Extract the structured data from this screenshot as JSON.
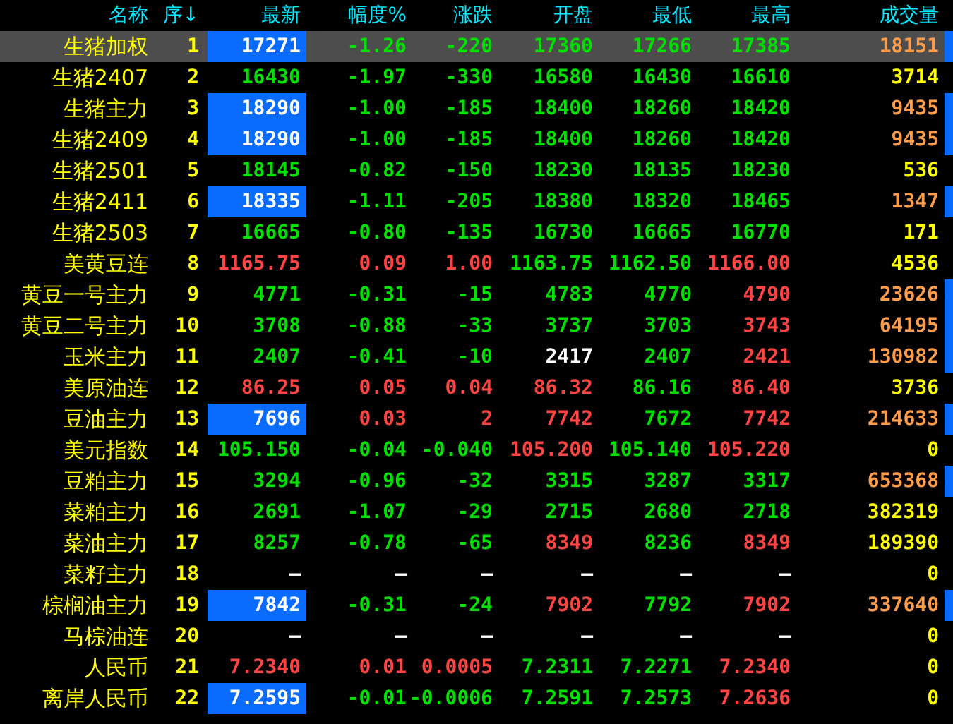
{
  "columns": [
    "名称",
    "序↓",
    "最新",
    "幅度%",
    "涨跌",
    "开盘",
    "最低",
    "最高",
    "成交量"
  ],
  "rows": [
    {
      "name": "生猪加权",
      "seq": "1",
      "selected": true,
      "highlight": true,
      "marker": true,
      "cells": [
        {
          "text": "17271",
          "color": "#ffffff"
        },
        {
          "text": "-1.26",
          "color": "#00e000"
        },
        {
          "text": "-220",
          "color": "#00e000"
        },
        {
          "text": "17360",
          "color": "#00e000"
        },
        {
          "text": "17266",
          "color": "#00e000"
        },
        {
          "text": "17385",
          "color": "#00e000"
        },
        {
          "text": "18151",
          "color": "#ff9d4d"
        }
      ]
    },
    {
      "name": "生猪2407",
      "seq": "2",
      "selected": false,
      "highlight": false,
      "marker": false,
      "cells": [
        {
          "text": "16430",
          "color": "#00e000"
        },
        {
          "text": "-1.97",
          "color": "#00e000"
        },
        {
          "text": "-330",
          "color": "#00e000"
        },
        {
          "text": "16580",
          "color": "#00e000"
        },
        {
          "text": "16430",
          "color": "#00e000"
        },
        {
          "text": "16610",
          "color": "#00e000"
        },
        {
          "text": "3714",
          "color": "#ffff00"
        }
      ]
    },
    {
      "name": "生猪主力",
      "seq": "3",
      "selected": false,
      "highlight": true,
      "marker": true,
      "cells": [
        {
          "text": "18290",
          "color": "#ffffff"
        },
        {
          "text": "-1.00",
          "color": "#00e000"
        },
        {
          "text": "-185",
          "color": "#00e000"
        },
        {
          "text": "18400",
          "color": "#00e000"
        },
        {
          "text": "18260",
          "color": "#00e000"
        },
        {
          "text": "18420",
          "color": "#00e000"
        },
        {
          "text": "9435",
          "color": "#ff9d4d"
        }
      ]
    },
    {
      "name": "生猪2409",
      "seq": "4",
      "selected": false,
      "highlight": true,
      "marker": true,
      "cells": [
        {
          "text": "18290",
          "color": "#ffffff"
        },
        {
          "text": "-1.00",
          "color": "#00e000"
        },
        {
          "text": "-185",
          "color": "#00e000"
        },
        {
          "text": "18400",
          "color": "#00e000"
        },
        {
          "text": "18260",
          "color": "#00e000"
        },
        {
          "text": "18420",
          "color": "#00e000"
        },
        {
          "text": "9435",
          "color": "#ff9d4d"
        }
      ]
    },
    {
      "name": "生猪2501",
      "seq": "5",
      "selected": false,
      "highlight": false,
      "marker": false,
      "cells": [
        {
          "text": "18145",
          "color": "#00e000"
        },
        {
          "text": "-0.82",
          "color": "#00e000"
        },
        {
          "text": "-150",
          "color": "#00e000"
        },
        {
          "text": "18230",
          "color": "#00e000"
        },
        {
          "text": "18135",
          "color": "#00e000"
        },
        {
          "text": "18230",
          "color": "#00e000"
        },
        {
          "text": "536",
          "color": "#ffff00"
        }
      ]
    },
    {
      "name": "生猪2411",
      "seq": "6",
      "selected": false,
      "highlight": true,
      "marker": true,
      "cells": [
        {
          "text": "18335",
          "color": "#ffffff"
        },
        {
          "text": "-1.11",
          "color": "#00e000"
        },
        {
          "text": "-205",
          "color": "#00e000"
        },
        {
          "text": "18380",
          "color": "#00e000"
        },
        {
          "text": "18320",
          "color": "#00e000"
        },
        {
          "text": "18465",
          "color": "#00e000"
        },
        {
          "text": "1347",
          "color": "#ff9d4d"
        }
      ]
    },
    {
      "name": "生猪2503",
      "seq": "7",
      "selected": false,
      "highlight": false,
      "marker": false,
      "cells": [
        {
          "text": "16665",
          "color": "#00e000"
        },
        {
          "text": "-0.80",
          "color": "#00e000"
        },
        {
          "text": "-135",
          "color": "#00e000"
        },
        {
          "text": "16730",
          "color": "#00e000"
        },
        {
          "text": "16665",
          "color": "#00e000"
        },
        {
          "text": "16770",
          "color": "#00e000"
        },
        {
          "text": "171",
          "color": "#ffff00"
        }
      ]
    },
    {
      "name": "美黄豆连",
      "seq": "8",
      "selected": false,
      "highlight": false,
      "marker": false,
      "cells": [
        {
          "text": "1165.75",
          "color": "#ff4444"
        },
        {
          "text": "0.09",
          "color": "#ff4444"
        },
        {
          "text": "1.00",
          "color": "#ff4444"
        },
        {
          "text": "1163.75",
          "color": "#00e000"
        },
        {
          "text": "1162.50",
          "color": "#00e000"
        },
        {
          "text": "1166.00",
          "color": "#ff4444"
        },
        {
          "text": "4536",
          "color": "#ffff00"
        }
      ]
    },
    {
      "name": "黄豆一号主力",
      "seq": "9",
      "selected": false,
      "highlight": false,
      "marker": true,
      "cells": [
        {
          "text": "4771",
          "color": "#00e000"
        },
        {
          "text": "-0.31",
          "color": "#00e000"
        },
        {
          "text": "-15",
          "color": "#00e000"
        },
        {
          "text": "4783",
          "color": "#00e000"
        },
        {
          "text": "4770",
          "color": "#00e000"
        },
        {
          "text": "4790",
          "color": "#ff4444"
        },
        {
          "text": "23626",
          "color": "#ff9d4d"
        }
      ]
    },
    {
      "name": "黄豆二号主力",
      "seq": "10",
      "selected": false,
      "highlight": false,
      "marker": true,
      "cells": [
        {
          "text": "3708",
          "color": "#00e000"
        },
        {
          "text": "-0.88",
          "color": "#00e000"
        },
        {
          "text": "-33",
          "color": "#00e000"
        },
        {
          "text": "3737",
          "color": "#00e000"
        },
        {
          "text": "3703",
          "color": "#00e000"
        },
        {
          "text": "3743",
          "color": "#ff4444"
        },
        {
          "text": "64195",
          "color": "#ff9d4d"
        }
      ]
    },
    {
      "name": "玉米主力",
      "seq": "11",
      "selected": false,
      "highlight": false,
      "marker": true,
      "cells": [
        {
          "text": "2407",
          "color": "#00e000"
        },
        {
          "text": "-0.41",
          "color": "#00e000"
        },
        {
          "text": "-10",
          "color": "#00e000"
        },
        {
          "text": "2417",
          "color": "#ffffff"
        },
        {
          "text": "2407",
          "color": "#00e000"
        },
        {
          "text": "2421",
          "color": "#ff4444"
        },
        {
          "text": "130982",
          "color": "#ff9d4d"
        }
      ]
    },
    {
      "name": "美原油连",
      "seq": "12",
      "selected": false,
      "highlight": false,
      "marker": false,
      "cells": [
        {
          "text": "86.25",
          "color": "#ff4444"
        },
        {
          "text": "0.05",
          "color": "#ff4444"
        },
        {
          "text": "0.04",
          "color": "#ff4444"
        },
        {
          "text": "86.32",
          "color": "#ff4444"
        },
        {
          "text": "86.16",
          "color": "#00e000"
        },
        {
          "text": "86.40",
          "color": "#ff4444"
        },
        {
          "text": "3736",
          "color": "#ffff00"
        }
      ]
    },
    {
      "name": "豆油主力",
      "seq": "13",
      "selected": false,
      "highlight": true,
      "marker": true,
      "cells": [
        {
          "text": "7696",
          "color": "#ffffff"
        },
        {
          "text": "0.03",
          "color": "#ff4444"
        },
        {
          "text": "2",
          "color": "#ff4444"
        },
        {
          "text": "7742",
          "color": "#ff4444"
        },
        {
          "text": "7672",
          "color": "#00e000"
        },
        {
          "text": "7742",
          "color": "#ff4444"
        },
        {
          "text": "214633",
          "color": "#ff9d4d"
        }
      ]
    },
    {
      "name": "美元指数",
      "seq": "14",
      "selected": false,
      "highlight": false,
      "marker": false,
      "cells": [
        {
          "text": "105.150",
          "color": "#00e000"
        },
        {
          "text": "-0.04",
          "color": "#00e000"
        },
        {
          "text": "-0.040",
          "color": "#00e000"
        },
        {
          "text": "105.200",
          "color": "#ff4444"
        },
        {
          "text": "105.140",
          "color": "#00e000"
        },
        {
          "text": "105.220",
          "color": "#ff4444"
        },
        {
          "text": "0",
          "color": "#ffff00"
        }
      ]
    },
    {
      "name": "豆粕主力",
      "seq": "15",
      "selected": false,
      "highlight": false,
      "marker": true,
      "cells": [
        {
          "text": "3294",
          "color": "#00e000"
        },
        {
          "text": "-0.96",
          "color": "#00e000"
        },
        {
          "text": "-32",
          "color": "#00e000"
        },
        {
          "text": "3315",
          "color": "#00e000"
        },
        {
          "text": "3287",
          "color": "#00e000"
        },
        {
          "text": "3317",
          "color": "#00e000"
        },
        {
          "text": "653368",
          "color": "#ff9d4d"
        }
      ]
    },
    {
      "name": "菜粕主力",
      "seq": "16",
      "selected": false,
      "highlight": false,
      "marker": false,
      "cells": [
        {
          "text": "2691",
          "color": "#00e000"
        },
        {
          "text": "-1.07",
          "color": "#00e000"
        },
        {
          "text": "-29",
          "color": "#00e000"
        },
        {
          "text": "2715",
          "color": "#00e000"
        },
        {
          "text": "2680",
          "color": "#00e000"
        },
        {
          "text": "2718",
          "color": "#00e000"
        },
        {
          "text": "382319",
          "color": "#ffff00"
        }
      ]
    },
    {
      "name": "菜油主力",
      "seq": "17",
      "selected": false,
      "highlight": false,
      "marker": false,
      "cells": [
        {
          "text": "8257",
          "color": "#00e000"
        },
        {
          "text": "-0.78",
          "color": "#00e000"
        },
        {
          "text": "-65",
          "color": "#00e000"
        },
        {
          "text": "8349",
          "color": "#ff4444"
        },
        {
          "text": "8236",
          "color": "#00e000"
        },
        {
          "text": "8349",
          "color": "#ff4444"
        },
        {
          "text": "189390",
          "color": "#ffff00"
        }
      ]
    },
    {
      "name": "菜籽主力",
      "seq": "18",
      "selected": false,
      "highlight": false,
      "marker": false,
      "cells": [
        {
          "text": "—",
          "color": "#ffffff"
        },
        {
          "text": "—",
          "color": "#ffffff"
        },
        {
          "text": "—",
          "color": "#ffffff"
        },
        {
          "text": "—",
          "color": "#ffffff"
        },
        {
          "text": "—",
          "color": "#ffffff"
        },
        {
          "text": "—",
          "color": "#ffffff"
        },
        {
          "text": "0",
          "color": "#ffff00"
        }
      ]
    },
    {
      "name": "棕榈油主力",
      "seq": "19",
      "selected": false,
      "highlight": true,
      "marker": true,
      "cells": [
        {
          "text": "7842",
          "color": "#ffffff"
        },
        {
          "text": "-0.31",
          "color": "#00e000"
        },
        {
          "text": "-24",
          "color": "#00e000"
        },
        {
          "text": "7902",
          "color": "#ff4444"
        },
        {
          "text": "7792",
          "color": "#00e000"
        },
        {
          "text": "7902",
          "color": "#ff4444"
        },
        {
          "text": "337640",
          "color": "#ff9d4d"
        }
      ]
    },
    {
      "name": "马棕油连",
      "seq": "20",
      "selected": false,
      "highlight": false,
      "marker": false,
      "cells": [
        {
          "text": "—",
          "color": "#ffffff"
        },
        {
          "text": "—",
          "color": "#ffffff"
        },
        {
          "text": "—",
          "color": "#ffffff"
        },
        {
          "text": "—",
          "color": "#ffffff"
        },
        {
          "text": "—",
          "color": "#ffffff"
        },
        {
          "text": "—",
          "color": "#ffffff"
        },
        {
          "text": "0",
          "color": "#ffff00"
        }
      ]
    },
    {
      "name": "人民币",
      "seq": "21",
      "selected": false,
      "highlight": false,
      "marker": false,
      "cells": [
        {
          "text": "7.2340",
          "color": "#ff4444"
        },
        {
          "text": "0.01",
          "color": "#ff4444"
        },
        {
          "text": "0.0005",
          "color": "#ff4444"
        },
        {
          "text": "7.2311",
          "color": "#00e000"
        },
        {
          "text": "7.2271",
          "color": "#00e000"
        },
        {
          "text": "7.2340",
          "color": "#ff4444"
        },
        {
          "text": "0",
          "color": "#ffff00"
        }
      ]
    },
    {
      "name": "离岸人民币",
      "seq": "22",
      "selected": false,
      "highlight": true,
      "marker": false,
      "cells": [
        {
          "text": "7.2595",
          "color": "#ffffff"
        },
        {
          "text": "-0.01",
          "color": "#00e000"
        },
        {
          "text": "-0.0006",
          "color": "#00e000"
        },
        {
          "text": "7.2591",
          "color": "#00e000"
        },
        {
          "text": "7.2573",
          "color": "#00e000"
        },
        {
          "text": "7.2636",
          "color": "#ff4444"
        },
        {
          "text": "0",
          "color": "#ffff00"
        }
      ]
    }
  ]
}
